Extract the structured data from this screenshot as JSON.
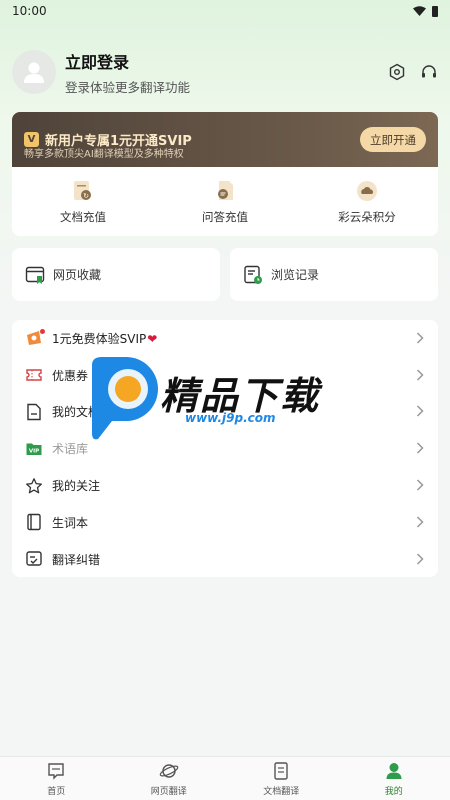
{
  "status_bar": {
    "time": "10:00"
  },
  "profile": {
    "title": "立即登录",
    "subtitle": "登录体验更多翻译功能",
    "actions": [
      "settings-icon",
      "headset-icon"
    ]
  },
  "vip": {
    "badge": "V",
    "title": "新用户专属1元开通SVIP",
    "subtitle": "畅享多款顶尖AI翻译模型及多种特权",
    "button": "立即开通",
    "items": [
      {
        "label": "文档充值",
        "icon": "document-recharge-icon"
      },
      {
        "label": "问答充值",
        "icon": "qa-recharge-icon"
      },
      {
        "label": "彩云朵积分",
        "icon": "cloud-points-icon"
      }
    ]
  },
  "quick": [
    {
      "label": "网页收藏",
      "icon": "web-bookmark-icon"
    },
    {
      "label": "浏览记录",
      "icon": "browse-history-icon"
    }
  ],
  "menu": [
    {
      "label": "1元免费体验SVIP",
      "suffix": "❤",
      "icon": "gift-icon"
    },
    {
      "label": "优惠券",
      "icon": "coupon-icon"
    },
    {
      "label": "我的文档",
      "icon": "document-icon"
    },
    {
      "label": "术语库",
      "icon": "vip-folder-icon"
    },
    {
      "label": "我的关注",
      "icon": "star-icon"
    },
    {
      "label": "生词本",
      "icon": "notebook-icon"
    },
    {
      "label": "翻译纠错",
      "icon": "feedback-icon"
    }
  ],
  "watermark": {
    "text": "精品下载",
    "url": "www.j9p.com"
  },
  "bottom_nav": [
    {
      "label": "首页",
      "icon": "home-icon"
    },
    {
      "label": "网页翻译",
      "icon": "planet-icon"
    },
    {
      "label": "文档翻译",
      "icon": "doc-translate-icon"
    },
    {
      "label": "我的",
      "icon": "profile-icon",
      "active": true
    }
  ],
  "colors": {
    "accent": "#2e9c4a",
    "vip_dark": "#4f4339",
    "vip_gold": "#f4d9a7"
  }
}
